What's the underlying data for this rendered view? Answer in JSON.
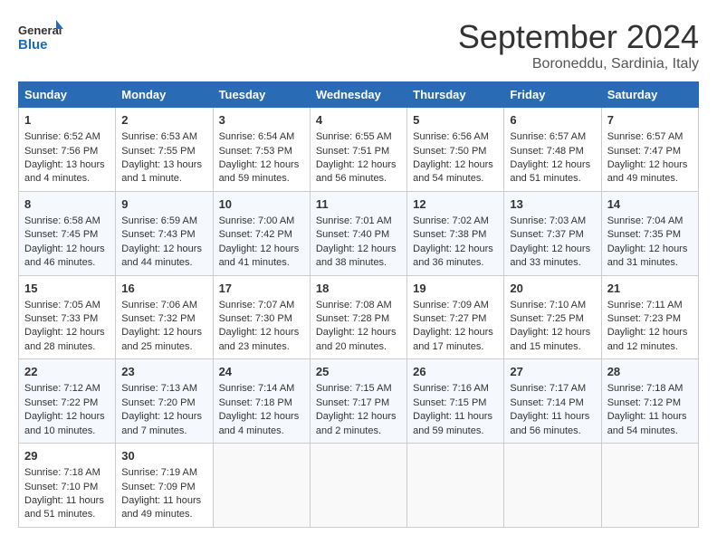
{
  "header": {
    "logo_general": "General",
    "logo_blue": "Blue",
    "month_title": "September 2024",
    "location": "Boroneddu, Sardinia, Italy"
  },
  "calendar": {
    "headers": [
      "Sunday",
      "Monday",
      "Tuesday",
      "Wednesday",
      "Thursday",
      "Friday",
      "Saturday"
    ],
    "weeks": [
      [
        {
          "day": "1",
          "lines": [
            "Sunrise: 6:52 AM",
            "Sunset: 7:56 PM",
            "Daylight: 13 hours",
            "and 4 minutes."
          ]
        },
        {
          "day": "2",
          "lines": [
            "Sunrise: 6:53 AM",
            "Sunset: 7:55 PM",
            "Daylight: 13 hours",
            "and 1 minute."
          ]
        },
        {
          "day": "3",
          "lines": [
            "Sunrise: 6:54 AM",
            "Sunset: 7:53 PM",
            "Daylight: 12 hours",
            "and 59 minutes."
          ]
        },
        {
          "day": "4",
          "lines": [
            "Sunrise: 6:55 AM",
            "Sunset: 7:51 PM",
            "Daylight: 12 hours",
            "and 56 minutes."
          ]
        },
        {
          "day": "5",
          "lines": [
            "Sunrise: 6:56 AM",
            "Sunset: 7:50 PM",
            "Daylight: 12 hours",
            "and 54 minutes."
          ]
        },
        {
          "day": "6",
          "lines": [
            "Sunrise: 6:57 AM",
            "Sunset: 7:48 PM",
            "Daylight: 12 hours",
            "and 51 minutes."
          ]
        },
        {
          "day": "7",
          "lines": [
            "Sunrise: 6:57 AM",
            "Sunset: 7:47 PM",
            "Daylight: 12 hours",
            "and 49 minutes."
          ]
        }
      ],
      [
        {
          "day": "8",
          "lines": [
            "Sunrise: 6:58 AM",
            "Sunset: 7:45 PM",
            "Daylight: 12 hours",
            "and 46 minutes."
          ]
        },
        {
          "day": "9",
          "lines": [
            "Sunrise: 6:59 AM",
            "Sunset: 7:43 PM",
            "Daylight: 12 hours",
            "and 44 minutes."
          ]
        },
        {
          "day": "10",
          "lines": [
            "Sunrise: 7:00 AM",
            "Sunset: 7:42 PM",
            "Daylight: 12 hours",
            "and 41 minutes."
          ]
        },
        {
          "day": "11",
          "lines": [
            "Sunrise: 7:01 AM",
            "Sunset: 7:40 PM",
            "Daylight: 12 hours",
            "and 38 minutes."
          ]
        },
        {
          "day": "12",
          "lines": [
            "Sunrise: 7:02 AM",
            "Sunset: 7:38 PM",
            "Daylight: 12 hours",
            "and 36 minutes."
          ]
        },
        {
          "day": "13",
          "lines": [
            "Sunrise: 7:03 AM",
            "Sunset: 7:37 PM",
            "Daylight: 12 hours",
            "and 33 minutes."
          ]
        },
        {
          "day": "14",
          "lines": [
            "Sunrise: 7:04 AM",
            "Sunset: 7:35 PM",
            "Daylight: 12 hours",
            "and 31 minutes."
          ]
        }
      ],
      [
        {
          "day": "15",
          "lines": [
            "Sunrise: 7:05 AM",
            "Sunset: 7:33 PM",
            "Daylight: 12 hours",
            "and 28 minutes."
          ]
        },
        {
          "day": "16",
          "lines": [
            "Sunrise: 7:06 AM",
            "Sunset: 7:32 PM",
            "Daylight: 12 hours",
            "and 25 minutes."
          ]
        },
        {
          "day": "17",
          "lines": [
            "Sunrise: 7:07 AM",
            "Sunset: 7:30 PM",
            "Daylight: 12 hours",
            "and 23 minutes."
          ]
        },
        {
          "day": "18",
          "lines": [
            "Sunrise: 7:08 AM",
            "Sunset: 7:28 PM",
            "Daylight: 12 hours",
            "and 20 minutes."
          ]
        },
        {
          "day": "19",
          "lines": [
            "Sunrise: 7:09 AM",
            "Sunset: 7:27 PM",
            "Daylight: 12 hours",
            "and 17 minutes."
          ]
        },
        {
          "day": "20",
          "lines": [
            "Sunrise: 7:10 AM",
            "Sunset: 7:25 PM",
            "Daylight: 12 hours",
            "and 15 minutes."
          ]
        },
        {
          "day": "21",
          "lines": [
            "Sunrise: 7:11 AM",
            "Sunset: 7:23 PM",
            "Daylight: 12 hours",
            "and 12 minutes."
          ]
        }
      ],
      [
        {
          "day": "22",
          "lines": [
            "Sunrise: 7:12 AM",
            "Sunset: 7:22 PM",
            "Daylight: 12 hours",
            "and 10 minutes."
          ]
        },
        {
          "day": "23",
          "lines": [
            "Sunrise: 7:13 AM",
            "Sunset: 7:20 PM",
            "Daylight: 12 hours",
            "and 7 minutes."
          ]
        },
        {
          "day": "24",
          "lines": [
            "Sunrise: 7:14 AM",
            "Sunset: 7:18 PM",
            "Daylight: 12 hours",
            "and 4 minutes."
          ]
        },
        {
          "day": "25",
          "lines": [
            "Sunrise: 7:15 AM",
            "Sunset: 7:17 PM",
            "Daylight: 12 hours",
            "and 2 minutes."
          ]
        },
        {
          "day": "26",
          "lines": [
            "Sunrise: 7:16 AM",
            "Sunset: 7:15 PM",
            "Daylight: 11 hours",
            "and 59 minutes."
          ]
        },
        {
          "day": "27",
          "lines": [
            "Sunrise: 7:17 AM",
            "Sunset: 7:14 PM",
            "Daylight: 11 hours",
            "and 56 minutes."
          ]
        },
        {
          "day": "28",
          "lines": [
            "Sunrise: 7:18 AM",
            "Sunset: 7:12 PM",
            "Daylight: 11 hours",
            "and 54 minutes."
          ]
        }
      ],
      [
        {
          "day": "29",
          "lines": [
            "Sunrise: 7:18 AM",
            "Sunset: 7:10 PM",
            "Daylight: 11 hours",
            "and 51 minutes."
          ]
        },
        {
          "day": "30",
          "lines": [
            "Sunrise: 7:19 AM",
            "Sunset: 7:09 PM",
            "Daylight: 11 hours",
            "and 49 minutes."
          ]
        },
        {
          "day": "",
          "lines": []
        },
        {
          "day": "",
          "lines": []
        },
        {
          "day": "",
          "lines": []
        },
        {
          "day": "",
          "lines": []
        },
        {
          "day": "",
          "lines": []
        }
      ]
    ]
  }
}
